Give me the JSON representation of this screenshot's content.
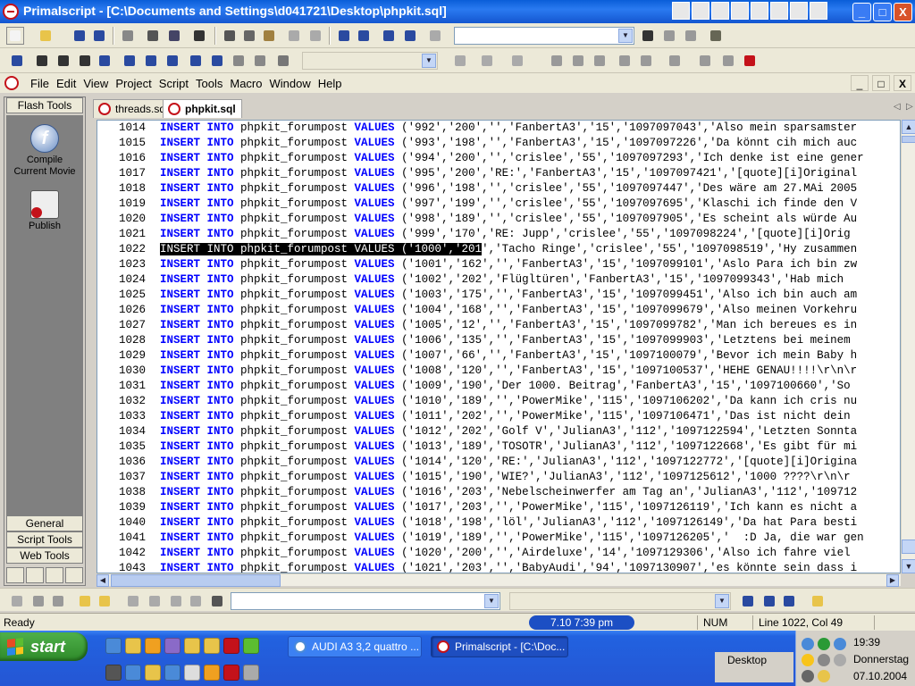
{
  "window": {
    "app_name": "Primalscript",
    "title": "Primalscript - [C:\\Documents and Settings\\d041721\\Desktop\\phpkit.sql]",
    "controls": [
      "_",
      "□",
      "X"
    ]
  },
  "menubar": {
    "items": [
      "File",
      "Edit",
      "View",
      "Project",
      "Script",
      "Tools",
      "Macro",
      "Window",
      "Help"
    ]
  },
  "left_panel": {
    "header": "Flash Tools",
    "tools": [
      {
        "label": "Compile\nCurrent Movie",
        "icon": "flash-icon"
      },
      {
        "label": "Publish",
        "icon": "publish-icon"
      }
    ],
    "bottom_tabs": [
      "General",
      "Script Tools",
      "Web Tools"
    ]
  },
  "tabs": [
    {
      "label": "threads.sql",
      "active": false
    },
    {
      "label": "phpkit.sql",
      "active": true
    }
  ],
  "editor": {
    "lines": [
      {
        "num": "1014",
        "kw1": "INSERT INTO",
        "table": " phpkit_forumpost ",
        "kw2": "VALUES",
        "rest": " ('992','200','','FanbertA3','15','1097097043','Also mein sparsamster"
      },
      {
        "num": "1015",
        "kw1": "INSERT INTO",
        "table": " phpkit_forumpost ",
        "kw2": "VALUES",
        "rest": " ('993','198','','FanbertA3','15','1097097226','Da könnt cih mich auc"
      },
      {
        "num": "1016",
        "kw1": "INSERT INTO",
        "table": " phpkit_forumpost ",
        "kw2": "VALUES",
        "rest": " ('994','200','','crislee','55','1097097293','Ich denke ist eine gener"
      },
      {
        "num": "1017",
        "kw1": "INSERT INTO",
        "table": " phpkit_forumpost ",
        "kw2": "VALUES",
        "rest": " ('995','200','RE:','FanbertA3','15','1097097421','[quote][i]Original"
      },
      {
        "num": "1018",
        "kw1": "INSERT INTO",
        "table": " phpkit_forumpost ",
        "kw2": "VALUES",
        "rest": " ('996','198','','crislee','55','1097097447','Des wäre am 27.MAi 2005"
      },
      {
        "num": "1019",
        "kw1": "INSERT INTO",
        "table": " phpkit_forumpost ",
        "kw2": "VALUES",
        "rest": " ('997','199','','crislee','55','1097097695','Klaschi ich finde den V"
      },
      {
        "num": "1020",
        "kw1": "INSERT INTO",
        "table": " phpkit_forumpost ",
        "kw2": "VALUES",
        "rest": " ('998','189','','crislee','55','1097097905','Es scheint als würde Au"
      },
      {
        "num": "1021",
        "kw1": "INSERT INTO",
        "table": " phpkit_forumpost ",
        "kw2": "VALUES",
        "rest": " ('999','170','RE: Jupp','crislee','55','1097098224','[quote][i]Orig"
      },
      {
        "num": "1022",
        "selected": "INSERT INTO phpkit_forumpost VALUES ('1000','201",
        "rest": "','Tacho Ringe','crislee','55','1097098519','Hy zusammen"
      },
      {
        "num": "1023",
        "kw1": "INSERT INTO",
        "table": " phpkit_forumpost ",
        "kw2": "VALUES",
        "rest": " ('1001','162','','FanbertA3','15','1097099101','Aslo Para ich bin zw"
      },
      {
        "num": "1024",
        "kw1": "INSERT INTO",
        "table": " phpkit_forumpost ",
        "kw2": "VALUES",
        "rest": " ('1002','202','Flügltüren','FanbertA3','15','1097099343','Hab mich"
      },
      {
        "num": "1025",
        "kw1": "INSERT INTO",
        "table": " phpkit_forumpost ",
        "kw2": "VALUES",
        "rest": " ('1003','175','','FanbertA3','15','1097099451','Also ich bin auch am"
      },
      {
        "num": "1026",
        "kw1": "INSERT INTO",
        "table": " phpkit_forumpost ",
        "kw2": "VALUES",
        "rest": " ('1004','168','','FanbertA3','15','1097099679','Also meinen Vorkehru"
      },
      {
        "num": "1027",
        "kw1": "INSERT INTO",
        "table": " phpkit_forumpost ",
        "kw2": "VALUES",
        "rest": " ('1005','12','','FanbertA3','15','1097099782','Man ich bereues es in"
      },
      {
        "num": "1028",
        "kw1": "INSERT INTO",
        "table": " phpkit_forumpost ",
        "kw2": "VALUES",
        "rest": " ('1006','135','','FanbertA3','15','1097099903','Letztens bei meinem"
      },
      {
        "num": "1029",
        "kw1": "INSERT INTO",
        "table": " phpkit_forumpost ",
        "kw2": "VALUES",
        "rest": " ('1007','66','','FanbertA3','15','1097100079','Bevor ich mein Baby h"
      },
      {
        "num": "1030",
        "kw1": "INSERT INTO",
        "table": " phpkit_forumpost ",
        "kw2": "VALUES",
        "rest": " ('1008','120','','FanbertA3','15','1097100537','HEHE GENAU!!!!\\r\\n\\r"
      },
      {
        "num": "1031",
        "kw1": "INSERT INTO",
        "table": " phpkit_forumpost ",
        "kw2": "VALUES",
        "rest": " ('1009','190','Der 1000. Beitrag','FanbertA3','15','1097100660','So"
      },
      {
        "num": "1032",
        "kw1": "INSERT INTO",
        "table": " phpkit_forumpost ",
        "kw2": "VALUES",
        "rest": " ('1010','189','','PowerMike','115','1097106202','Da kann ich cris nu"
      },
      {
        "num": "1033",
        "kw1": "INSERT INTO",
        "table": " phpkit_forumpost ",
        "kw2": "VALUES",
        "rest": " ('1011','202','','PowerMike','115','1097106471','Das ist nicht dein"
      },
      {
        "num": "1034",
        "kw1": "INSERT INTO",
        "table": " phpkit_forumpost ",
        "kw2": "VALUES",
        "rest": " ('1012','202','Golf V','JulianA3','112','1097122594','Letzten Sonnta"
      },
      {
        "num": "1035",
        "kw1": "INSERT INTO",
        "table": " phpkit_forumpost ",
        "kw2": "VALUES",
        "rest": " ('1013','189','TOSOTR','JulianA3','112','1097122668','Es gibt für mi"
      },
      {
        "num": "1036",
        "kw1": "INSERT INTO",
        "table": " phpkit_forumpost ",
        "kw2": "VALUES",
        "rest": " ('1014','120','RE:','JulianA3','112','1097122772','[quote][i]Origina"
      },
      {
        "num": "1037",
        "kw1": "INSERT INTO",
        "table": " phpkit_forumpost ",
        "kw2": "VALUES",
        "rest": " ('1015','190','WIE?','JulianA3','112','1097125612','1000 ????\\r\\n\\r"
      },
      {
        "num": "1038",
        "kw1": "INSERT INTO",
        "table": " phpkit_forumpost ",
        "kw2": "VALUES",
        "rest": " ('1016','203','Nebelscheinwerfer am Tag an','JulianA3','112','109712"
      },
      {
        "num": "1039",
        "kw1": "INSERT INTO",
        "table": " phpkit_forumpost ",
        "kw2": "VALUES",
        "rest": " ('1017','203','','PowerMike','115','1097126119','Ich kann es nicht a"
      },
      {
        "num": "1040",
        "kw1": "INSERT INTO",
        "table": " phpkit_forumpost ",
        "kw2": "VALUES",
        "rest": " ('1018','198','löl','JulianA3','112','1097126149','Da hat Para besti"
      },
      {
        "num": "1041",
        "kw1": "INSERT INTO",
        "table": " phpkit_forumpost ",
        "kw2": "VALUES",
        "rest": " ('1019','189','','PowerMike','115','1097126205','  :D Ja, die war gen"
      },
      {
        "num": "1042",
        "kw1": "INSERT INTO",
        "table": " phpkit_forumpost ",
        "kw2": "VALUES",
        "rest": " ('1020','200','','Airdeluxe','14','1097129306','Also ich fahre viel"
      },
      {
        "num": "1043",
        "kw1": "INSERT INTO",
        "table": " phpkit_forumpost ",
        "kw2": "VALUES",
        "rest": " ('1021','203','','BabyAudi','94','1097130907','es könnte sein dass i"
      }
    ]
  },
  "statusbar": {
    "ready": "Ready",
    "clock": "7.10  7:39 pm",
    "num": "NUM",
    "position": "Line  1022, Col  49"
  },
  "taskbar": {
    "start_label": "start",
    "tasks": [
      {
        "label": "AUDI A3 3,2 quattro ...",
        "active": false
      },
      {
        "label": "Primalscript - [C:\\Doc...",
        "active": true
      }
    ],
    "desktop_label": "Desktop",
    "time": "19:39",
    "day": "Donnerstag",
    "date": "07.10.2004"
  },
  "colors": {
    "keyword": "#0000ff",
    "titlebar": "#0a5ed8",
    "taskbar": "#2456d4",
    "start": "#3a9a36"
  }
}
